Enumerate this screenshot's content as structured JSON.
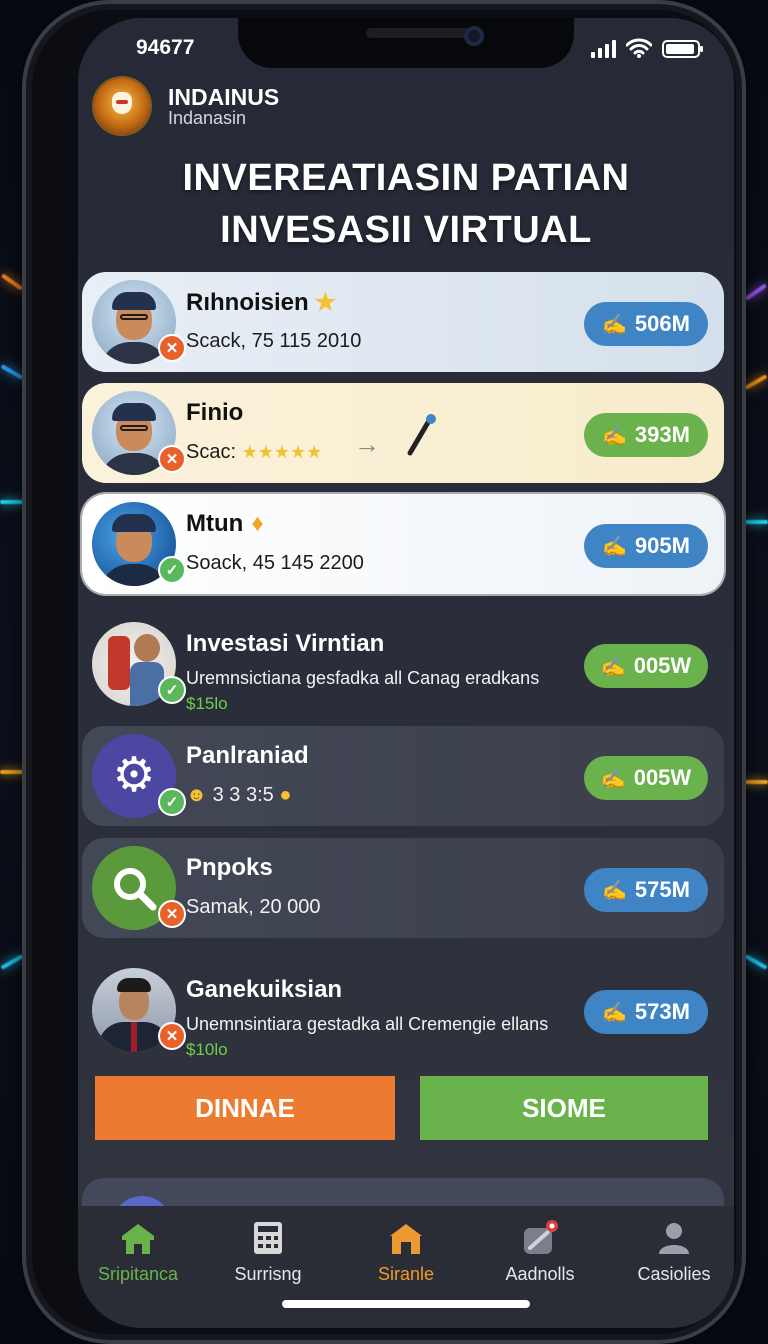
{
  "status_bar": {
    "time": "94677"
  },
  "brand": {
    "name": "INDAINUS",
    "subtitle": "Indanasin"
  },
  "headline": {
    "line1": "INVEREATIASIN PATIAN",
    "line2": "INVESASII VIRTUAL"
  },
  "cards": [
    {
      "title": "Rıhnoisien",
      "subtitle": "Scack, 75 115 2010",
      "value": "506M",
      "status": "x",
      "accent": "#3f85c6",
      "title_icon": "star-icon"
    },
    {
      "title": "Finio",
      "subtitle": "Scac:",
      "stars": "★★★★★",
      "value": "393M",
      "status": "x",
      "accent": "#6ab24c",
      "title_icon": ""
    },
    {
      "title": "Mtun",
      "subtitle": "Soack, 45 145 2200",
      "value": "905M",
      "status": "ok",
      "accent": "#3f85c6",
      "title_icon": "flame-icon"
    },
    {
      "title": "Investasi Virntian",
      "subtitle": "Uremnsictiana gesfadka all Canag eradkans",
      "price": "$15lo",
      "value": "005W",
      "status": "ok",
      "accent": "#6ab24c"
    },
    {
      "title": "Panlraniad",
      "subtitle": "3 3 3:5",
      "value": "005W",
      "status": "ok",
      "accent": "#6ab24c"
    },
    {
      "title": "Pnpoks",
      "subtitle": "Samak, 20 000",
      "value": "575M",
      "status": "x",
      "accent": "#3f85c6"
    },
    {
      "title": "Ganekuiksian",
      "subtitle": "Unemnsintiara gestadka all Cremengie ellans",
      "price": "$10lo",
      "value": "573M",
      "status": "x",
      "accent": "#3f85c6"
    }
  ],
  "buttons": {
    "left": "DINNAE",
    "right": "SIOME"
  },
  "tabs": [
    {
      "label": "Sripitanca",
      "icon": "home-icon",
      "color": "#6ab24c"
    },
    {
      "label": "Surrisng",
      "icon": "calculator-icon",
      "color": "#e6e6e6"
    },
    {
      "label": "Siranle",
      "icon": "store-icon",
      "color": "#ec9a30"
    },
    {
      "label": "Aadnolls",
      "icon": "tools-icon",
      "color": "#e6e6e6"
    },
    {
      "label": "Casiolies",
      "icon": "profile-icon",
      "color": "#e6e6e6"
    }
  ]
}
